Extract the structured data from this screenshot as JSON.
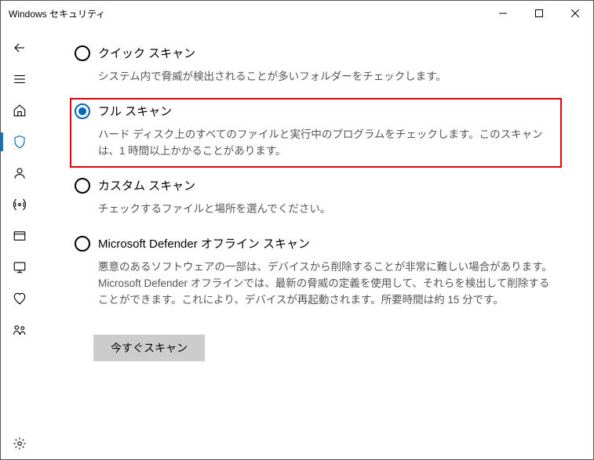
{
  "window": {
    "title": "Windows セキュリティ"
  },
  "options": {
    "quick": {
      "title": "クイック スキャン",
      "desc": "システム内で脅威が検出されることが多いフォルダーをチェックします。"
    },
    "full": {
      "title": "フル スキャン",
      "desc": "ハード ディスク上のすべてのファイルと実行中のプログラムをチェックします。このスキャンは、1 時間以上かかることがあります。"
    },
    "custom": {
      "title": "カスタム スキャン",
      "desc": "チェックするファイルと場所を選んでください。"
    },
    "offline": {
      "title": "Microsoft Defender オフライン スキャン",
      "desc": "悪意のあるソフトウェアの一部は、デバイスから削除することが非常に難しい場合があります。Microsoft Defender オフラインでは、最新の脅威の定義を使用して、それらを検出して削除することができます。これにより、デバイスが再起動されます。所要時間は約 15 分です。"
    }
  },
  "buttons": {
    "scan_now": "今すぐスキャン"
  }
}
